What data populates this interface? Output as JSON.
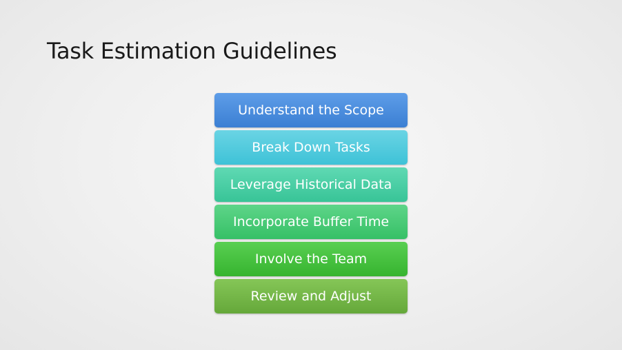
{
  "slide": {
    "title": "Task Estimation Guidelines"
  },
  "steps": [
    {
      "label": "Understand the Scope",
      "color_top": "#5e9de8",
      "color_bottom": "#3b7fd3"
    },
    {
      "label": "Break Down Tasks",
      "color_top": "#6ad4e4",
      "color_bottom": "#3ec2d7"
    },
    {
      "label": "Leverage Historical Data",
      "color_top": "#5fd9b3",
      "color_bottom": "#38c497"
    },
    {
      "label": "Incorporate Buffer Time",
      "color_top": "#5ed589",
      "color_bottom": "#36c066"
    },
    {
      "label": "Involve the Team",
      "color_top": "#59cf52",
      "color_bottom": "#36b42f"
    },
    {
      "label": "Review and Adjust",
      "color_top": "#85c657",
      "color_bottom": "#65a83a"
    }
  ]
}
